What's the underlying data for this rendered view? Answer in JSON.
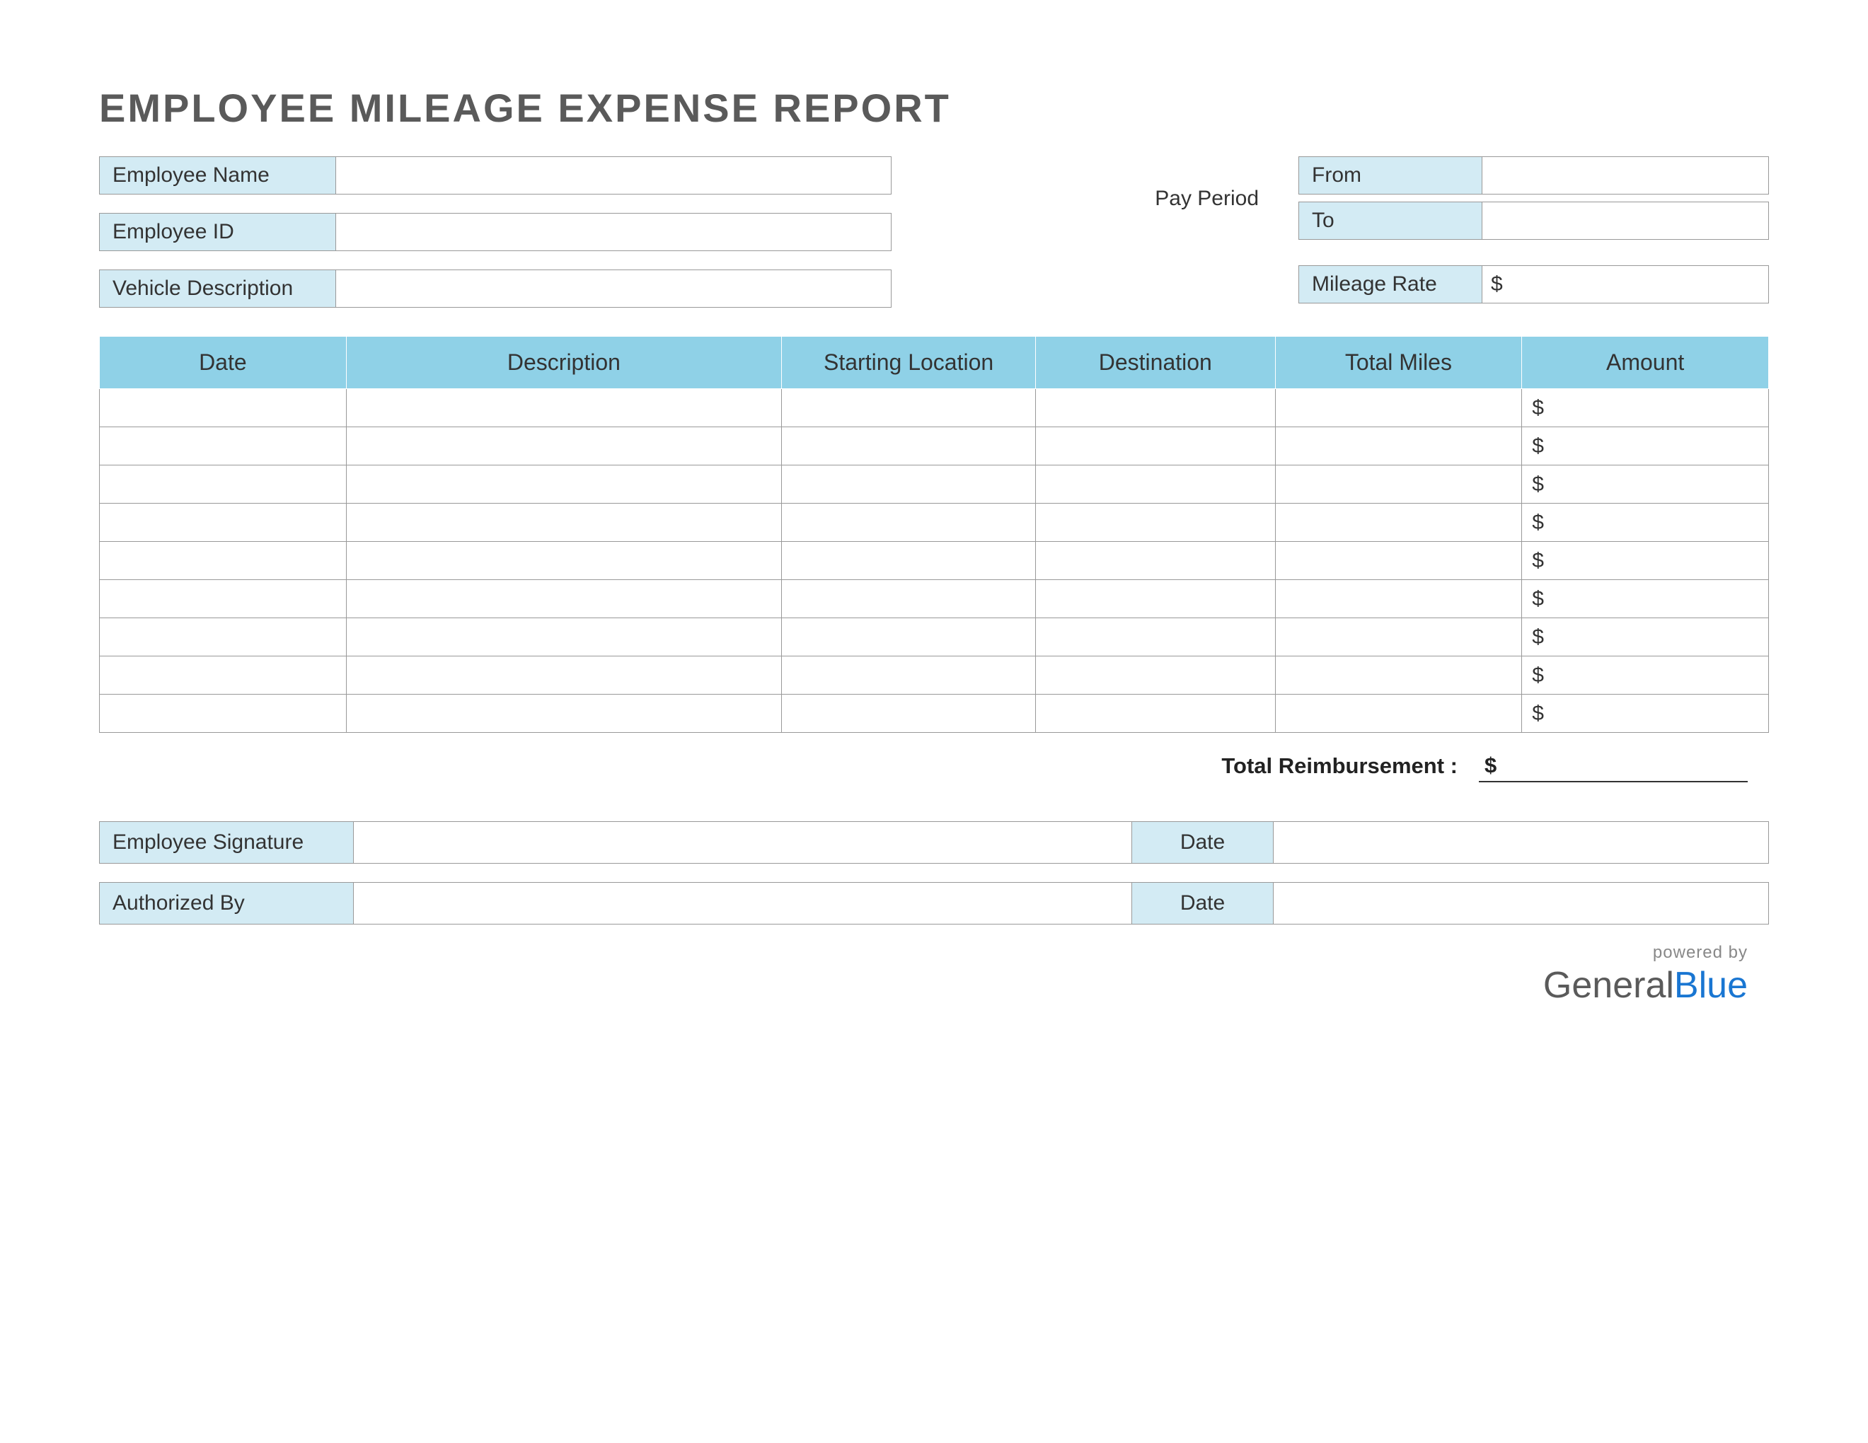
{
  "title": "EMPLOYEE MILEAGE EXPENSE REPORT",
  "fields": {
    "employee_name_label": "Employee Name",
    "employee_name_value": "",
    "employee_id_label": "Employee ID",
    "employee_id_value": "",
    "vehicle_description_label": "Vehicle Description",
    "vehicle_description_value": "",
    "pay_period_label": "Pay Period",
    "from_label": "From",
    "from_value": "",
    "to_label": "To",
    "to_value": "",
    "mileage_rate_label": "Mileage Rate",
    "mileage_rate_value": "$"
  },
  "table": {
    "headers": {
      "date": "Date",
      "description": "Description",
      "starting_location": "Starting Location",
      "destination": "Destination",
      "total_miles": "Total Miles",
      "amount": "Amount"
    },
    "rows": [
      {
        "date": "",
        "description": "",
        "starting_location": "",
        "destination": "",
        "total_miles": "",
        "amount": "$"
      },
      {
        "date": "",
        "description": "",
        "starting_location": "",
        "destination": "",
        "total_miles": "",
        "amount": "$"
      },
      {
        "date": "",
        "description": "",
        "starting_location": "",
        "destination": "",
        "total_miles": "",
        "amount": "$"
      },
      {
        "date": "",
        "description": "",
        "starting_location": "",
        "destination": "",
        "total_miles": "",
        "amount": "$"
      },
      {
        "date": "",
        "description": "",
        "starting_location": "",
        "destination": "",
        "total_miles": "",
        "amount": "$"
      },
      {
        "date": "",
        "description": "",
        "starting_location": "",
        "destination": "",
        "total_miles": "",
        "amount": "$"
      },
      {
        "date": "",
        "description": "",
        "starting_location": "",
        "destination": "",
        "total_miles": "",
        "amount": "$"
      },
      {
        "date": "",
        "description": "",
        "starting_location": "",
        "destination": "",
        "total_miles": "",
        "amount": "$"
      },
      {
        "date": "",
        "description": "",
        "starting_location": "",
        "destination": "",
        "total_miles": "",
        "amount": "$"
      }
    ]
  },
  "total": {
    "label": "Total Reimbursement :",
    "value": "$"
  },
  "signatures": {
    "employee_signature_label": "Employee Signature",
    "employee_signature_value": "",
    "employee_signature_date_label": "Date",
    "employee_signature_date_value": "",
    "authorized_by_label": "Authorized By",
    "authorized_by_value": "",
    "authorized_by_date_label": "Date",
    "authorized_by_date_value": ""
  },
  "footer": {
    "powered_by": "powered by",
    "logo_part1": "General",
    "logo_part2": "Blue"
  }
}
